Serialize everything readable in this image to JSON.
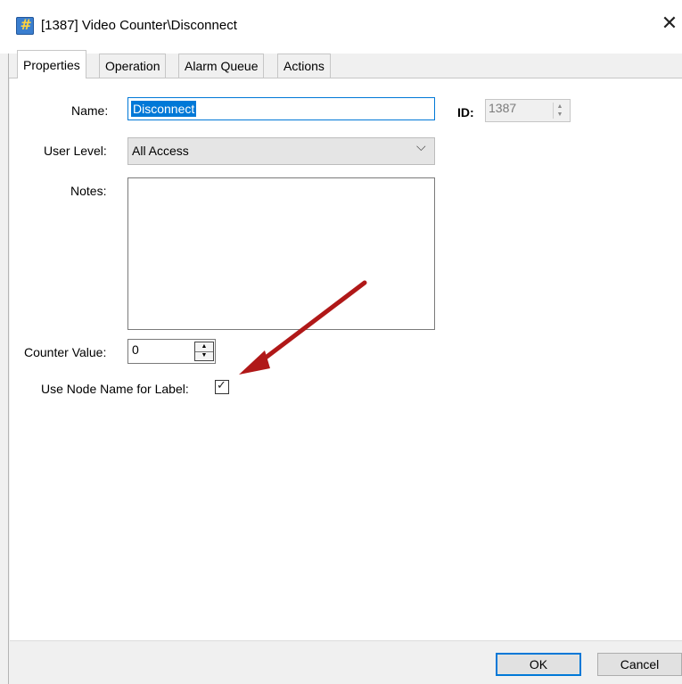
{
  "window": {
    "title": "[1387] Video Counter\\Disconnect",
    "icon": "hash-icon",
    "icon_glyph": "#",
    "close_glyph": "✕"
  },
  "tabs": [
    {
      "label": "Properties",
      "active": true
    },
    {
      "label": "Operation",
      "active": false
    },
    {
      "label": "Alarm Queue",
      "active": false
    },
    {
      "label": "Actions",
      "active": false
    }
  ],
  "form": {
    "name_label": "Name:",
    "name_value": "Disconnect",
    "id_label": "ID:",
    "id_value": "1387",
    "user_level_label": "User Level:",
    "user_level_value": "All Access",
    "notes_label": "Notes:",
    "notes_value": "",
    "counter_label": "Counter Value:",
    "counter_value": "0",
    "use_node_name_label": "Use Node Name for Label:",
    "use_node_name_checked": true,
    "check_glyph": "✓"
  },
  "buttons": {
    "ok": "OK",
    "cancel": "Cancel"
  },
  "annotation": {
    "arrow_color": "#b01818",
    "arrow_icon": "red-pointer-arrow"
  },
  "colors": {
    "selection": "#0078d7",
    "focus_border": "#0078d7"
  }
}
